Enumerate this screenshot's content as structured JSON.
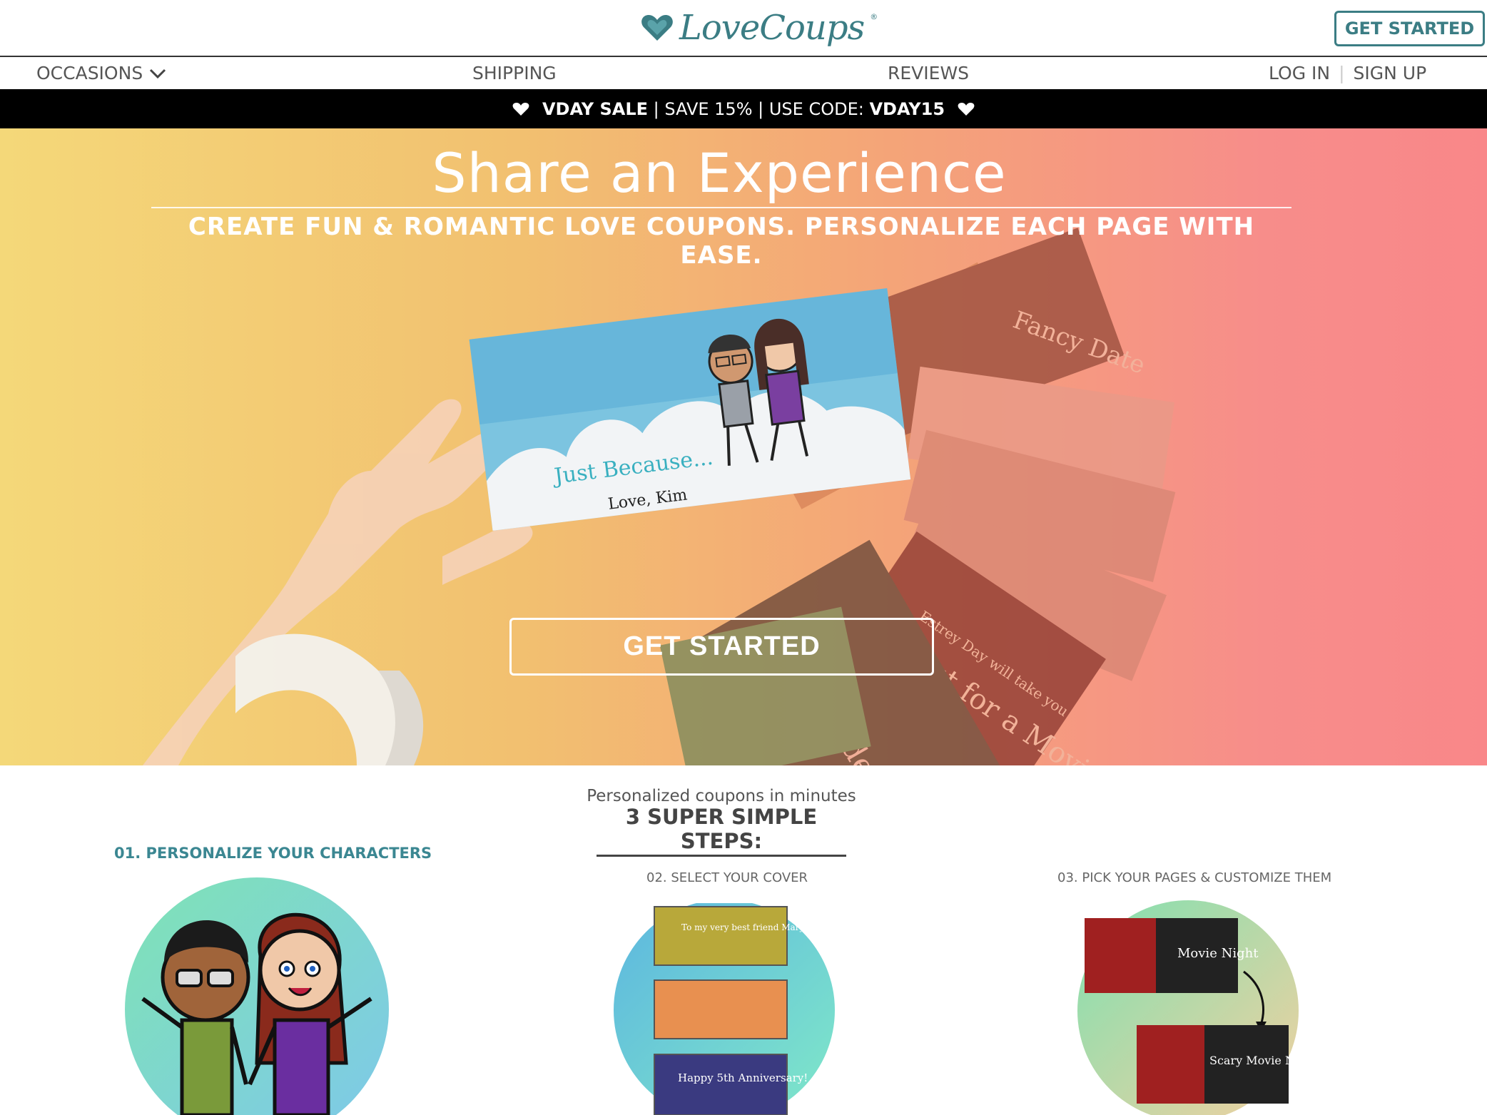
{
  "header": {
    "logo_text": "LoveCoups",
    "logo_tm": "®",
    "cta": "GET STARTED"
  },
  "nav": {
    "occasions": "OCCASIONS",
    "shipping": "SHIPPING",
    "reviews": "REVIEWS",
    "login": "LOG IN",
    "separator": "|",
    "signup": "SIGN UP"
  },
  "promo": {
    "sale": "VDAY SALE",
    "middle": "| SAVE 15% | USE CODE:",
    "code": "VDAY15"
  },
  "hero": {
    "title": "Share an Experience",
    "subtitle": "CREATE FUN & ROMANTIC LOVE COUPONS. PERSONALIZE EACH PAGE WITH EASE.",
    "cta": "GET STARTED",
    "card_main": "Just Because...",
    "card_sign": "Love, Kim",
    "card_movie": "Out for a Movie",
    "card_movie_sub": "Estrey Day will take you",
    "card_serenade": "Serenade You...",
    "card_date": "Fancy Date"
  },
  "steps": {
    "intro": "Personalized coupons in minutes",
    "title": "3 SUPER SIMPLE STEPS:",
    "step1": "01. PERSONALIZE YOUR CHARACTERS",
    "step2": "02. SELECT YOUR COVER",
    "step3": "03. PICK YOUR PAGES & CUSTOMIZE THEM",
    "cover1": "To my very best friend Mary!",
    "cover2": "Happy 5th Anniversary!",
    "page1": "Movie Night",
    "page2": "Scary Movie Night"
  },
  "colors": {
    "brand_teal": "#3b7d84",
    "promo_bg": "#000000",
    "hero_left": "#f4d879",
    "hero_right": "#f98789"
  }
}
